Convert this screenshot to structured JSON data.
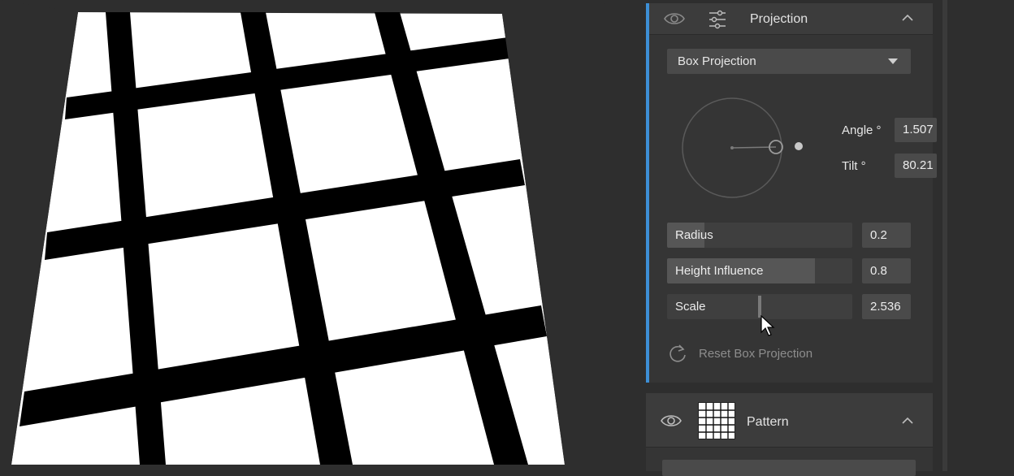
{
  "projection": {
    "title": "Projection",
    "mode": "Box Projection",
    "angle_label": "Angle °",
    "angle_value": "1.507",
    "tilt_label": "Tilt °",
    "tilt_value": "80.21",
    "sliders": {
      "radius": {
        "label": "Radius",
        "value": "0.2",
        "fraction": 0.2
      },
      "height_influence": {
        "label": "Height Influence",
        "value": "0.8",
        "fraction": 0.8
      },
      "scale": {
        "label": "Scale",
        "value": "2.536"
      }
    },
    "reset_label": "Reset Box Projection"
  },
  "pattern": {
    "title": "Pattern"
  },
  "colors": {
    "accent": "#3d8fd6",
    "panel_bg": "#353535",
    "header_bg": "#3c3c3c",
    "input_bg": "#4a4a4a"
  },
  "icons": [
    "eye-icon",
    "sliders-icon",
    "chevron-up-icon",
    "dropdown-arrow-icon",
    "reset-icon",
    "grid-pattern-icon",
    "mouse-cursor-icon"
  ]
}
